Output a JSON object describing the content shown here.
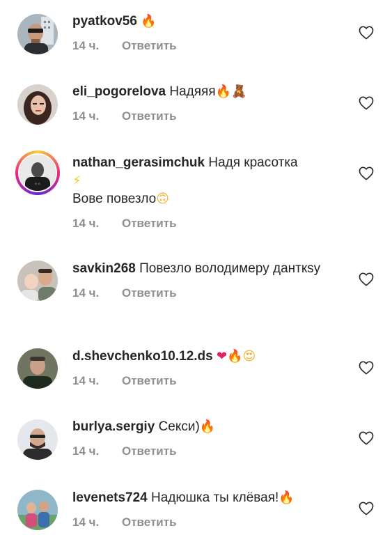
{
  "comments": [
    {
      "user": "pyatkov56",
      "text": "",
      "emoji": [
        {
          "icon": "fire-icon",
          "glyph": "🔥"
        }
      ],
      "text2": "",
      "emoji2": [],
      "time": "14 ч.",
      "reply": "Ответить"
    },
    {
      "user": "eli_pogorelova",
      "text": "Надяяя",
      "emoji": [
        {
          "icon": "fire-icon",
          "glyph": "🔥"
        },
        {
          "icon": "teddy-bear-icon",
          "glyph": "🧸"
        }
      ],
      "text2": "",
      "emoji2": [],
      "time": "14 ч.",
      "reply": "Ответить"
    },
    {
      "user": "nathan_gerasimchuk",
      "text": "Надя красотка",
      "emoji": [
        {
          "icon": "lightning-icon",
          "glyph": "⚡"
        }
      ],
      "text2": "Вове повезло",
      "emoji2": [
        {
          "icon": "upside-down-face-icon",
          "glyph": "🙃"
        }
      ],
      "time": "14 ч.",
      "reply": "Ответить"
    },
    {
      "user": "savkin268",
      "text": "Повезло володимеру данткsу",
      "emoji": [],
      "text2": "",
      "emoji2": [],
      "time": "14 ч.",
      "reply": "Ответить"
    },
    {
      "user": "d.shevchenko10.12.ds",
      "text": "",
      "emoji": [
        {
          "icon": "red-heart-icon",
          "glyph": "❤"
        },
        {
          "icon": "fire-icon",
          "glyph": "🔥"
        },
        {
          "icon": "heart-eyes-icon",
          "glyph": "😍"
        }
      ],
      "text2": "",
      "emoji2": [],
      "time": "14 ч.",
      "reply": "Ответить"
    },
    {
      "user": "burlya.sergiy",
      "text": "Секси)",
      "emoji": [
        {
          "icon": "fire-icon",
          "glyph": "🔥"
        }
      ],
      "text2": "",
      "emoji2": [],
      "time": "14 ч.",
      "reply": "Ответить"
    },
    {
      "user": "levenets724",
      "text": "Надюшка ты клёвая!",
      "emoji": [
        {
          "icon": "fire-icon",
          "glyph": "🔥"
        }
      ],
      "text2": "",
      "emoji2": [],
      "time": "14 ч.",
      "reply": "Ответить"
    }
  ]
}
